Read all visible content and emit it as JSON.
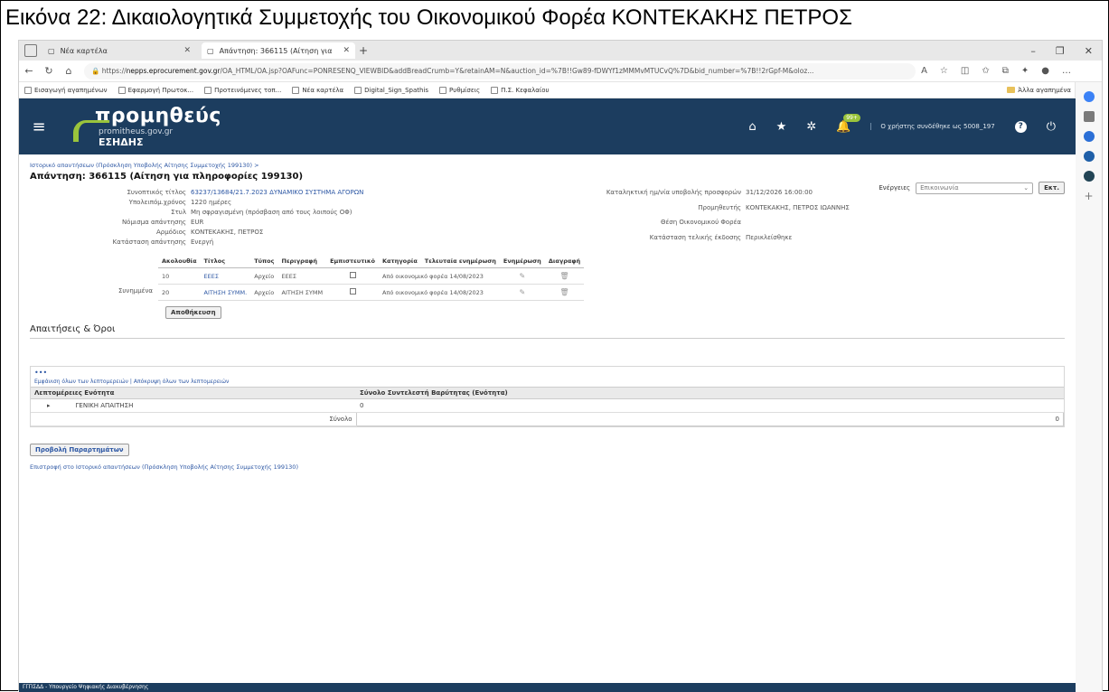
{
  "caption": "Εικόνα 22: Δικαιολογητικά Συμμετοχής του Οικονομικού Φορέα ΚΟΝΤΕΚΑΚΗΣ ΠΕΤΡΟΣ",
  "browser": {
    "tabs": [
      {
        "label": "Νέα καρτέλα"
      },
      {
        "label": "Απάντηση: 366115 (Αίτηση για"
      }
    ],
    "url_prefix": "https://",
    "url_domain": "nepps.eprocurement.gov.gr",
    "url_path": "/OA_HTML/OA.jsp?OAFunc=PONRESENQ_VIEWBID&addBreadCrumb=Y&retainAM=N&auction_id=%7B!!Gw89-fDWYf1zMMMvMTUCvQ%7D&bid_number=%7B!!2rGpf-M&oloz...",
    "bookmarks": [
      "Εισαγωγή αγαπημένων",
      "Εφαρμογή Πρωτοκ...",
      "Προτεινόμενες τοπ...",
      "Νέα καρτέλα",
      "Digital_Sign_Spathis",
      "Ρυθμίσεις",
      "Π.Σ. Κεφαλαίου"
    ],
    "other_favorites": "Άλλα αγαπημένα"
  },
  "header": {
    "logo_title": "προμηθεύς",
    "logo_sub1": "promitheus.gov.gr",
    "logo_sub2": "ΕΣΗΔΗΣ",
    "notif_badge": "99+",
    "user_text": "Ο χρήστης συνδέθηκε ως 5008_197"
  },
  "page": {
    "breadcrumb": "Ιστορικό απαντήσεων (Πρόσκληση Υποβολής Αίτησης Συμμετοχής 199130) >",
    "title": "Απάντηση: 366115 (Αίτηση για πληροφορίες 199130)",
    "actions_label": "Ενέργειες",
    "actions_value": "Επικοινωνία",
    "exec_button": "Εκτ."
  },
  "fields_left": [
    {
      "label": "Συνοπτικός τίτλος",
      "value": "63237/13684/21.7.2023 ΔΥΝΑΜΙΚΟ ΣΥΣΤΗΜΑ ΑΓΟΡΩΝ",
      "link": true
    },
    {
      "label": "Υπολειπόμ.χρόνος",
      "value": "1220 ημέρες",
      "link": false
    },
    {
      "label": "Στυλ",
      "value": "Μη σφραγισμένη (πρόσβαση από τους λοιπούς ΟΦ)",
      "link": false
    },
    {
      "label": "Νόμισμα απάντησης",
      "value": "EUR",
      "link": false
    },
    {
      "label": "Αρμόδιος",
      "value": "ΚΟΝΤΕΚΑΚΗΣ, ΠΕΤΡΟΣ",
      "link": false
    },
    {
      "label": "Κατάσταση απάντησης",
      "value": "Ενεργή",
      "link": false
    }
  ],
  "fields_right": [
    {
      "label": "Καταληκτική ημ/νία υποβολής προσφορών",
      "value": "31/12/2026 16:00:00"
    },
    {
      "label": "Προμηθευτής",
      "value": "ΚΟΝΤΕΚΑΚΗΣ, ΠΕΤΡΟΣ ΙΩΑΝΝΗΣ"
    },
    {
      "label": "Θέση Οικονομικού Φορέα",
      "value": ""
    },
    {
      "label": "Κατάσταση τελικής έκδοσης",
      "value": "Περικλείσθηκε"
    }
  ],
  "attachments": {
    "side_label": "Συνημμένα",
    "headers": [
      "Ακολουθία",
      "Τίτλος",
      "Τύπος",
      "Περιγραφή",
      "Εμπιστευτικό",
      "Κατηγορία",
      "Τελευταία ενημέρωση",
      "Ενημέρωση",
      "Διαγραφή"
    ],
    "rows": [
      {
        "seq": "10",
        "title": "ΕΕΕΣ",
        "type": "Αρχείο",
        "desc": "ΕΕΕΣ",
        "category": "Από οικονομικό φορέα",
        "updated": "14/08/2023"
      },
      {
        "seq": "20",
        "title": "ΑΙΤΗΣΗ ΣΥΜΜ.",
        "type": "Αρχείο",
        "desc": "ΑΙΤΗΣΗ ΣΥΜΜ",
        "category": "Από οικονομικό φορέα",
        "updated": "14/08/2023"
      }
    ],
    "save_button": "Αποθήκευση"
  },
  "requirements": {
    "title": "Απαιτήσεις & Όροι",
    "dots": "•••",
    "expand_text": "Εμφάνιση όλων των λεπτομερειών | Απόκρυψη όλων των λεπτομερειών",
    "col1": "Λεπτομέρειες Ενότητα",
    "col2": "Σύνολο Συντελεστή Βαρύτητας (Ενότητα)",
    "row_label": "ΓΕΝΙΚΗ ΑΠΑΙΤΗΣΗ",
    "row_value": "0",
    "total_label": "Σύνολο",
    "total_value": "0"
  },
  "preview_button": "Προβολή Παραρτημάτων",
  "back_link": "Επιστροφή στο Ιστορικό απαντήσεων (Πρόσκληση Υποβολής Αίτησης Συμμετοχής 199130)",
  "footer": "ΓΓΠΣΔΔ - Υπουργείο Ψηφιακής Διακυβέρνησης"
}
